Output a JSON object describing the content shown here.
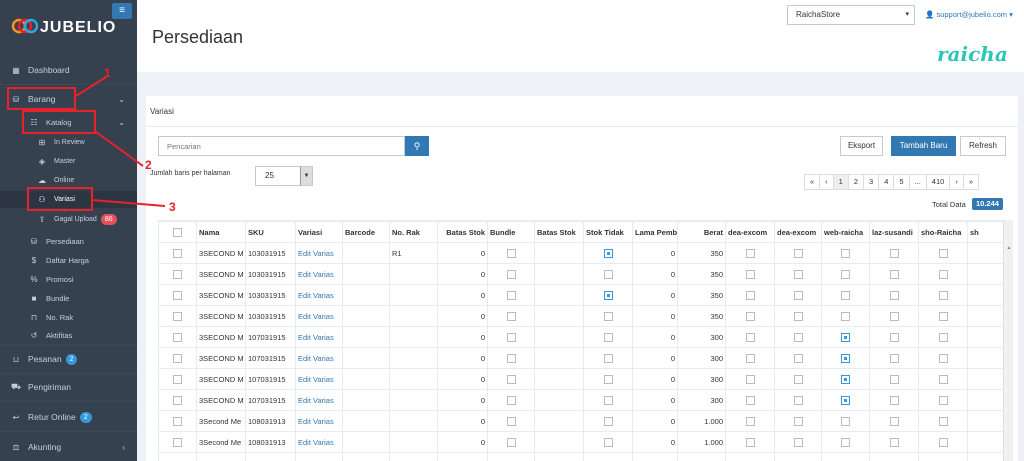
{
  "app": {
    "name": "JUBELIO",
    "menu_icon": "hamburger-icon"
  },
  "header": {
    "title": "Persediaan",
    "store": "RaichaStore",
    "user_email": "support@jubelio.com",
    "watermark": "raicha"
  },
  "sidebar": {
    "items": [
      {
        "label": "Dashboard",
        "icon": "chart-icon"
      },
      {
        "label": "Barang",
        "icon": "cubes-icon"
      },
      {
        "label": "Katalog",
        "icon": "grid-icon"
      },
      {
        "label": "In Review",
        "icon": "plus-square-icon"
      },
      {
        "label": "Master",
        "icon": "cube-icon"
      },
      {
        "label": "Online",
        "icon": "cloud-icon"
      },
      {
        "label": "Variasi",
        "icon": "sitemap-icon"
      },
      {
        "label": "Gagal Upload",
        "icon": "upload-icon",
        "badge": "86"
      },
      {
        "label": "Persediaan",
        "icon": "cubes-icon"
      },
      {
        "label": "Daftar Harga",
        "icon": "dollar-icon"
      },
      {
        "label": "Promosi",
        "icon": "percent-icon"
      },
      {
        "label": "Bundle",
        "icon": "square-icon"
      },
      {
        "label": "No. Rak",
        "icon": "bookmark-icon"
      },
      {
        "label": "Aktifitas",
        "icon": "history-icon"
      },
      {
        "label": "Pesanan",
        "icon": "basket-icon",
        "badge": "2"
      },
      {
        "label": "Pengiriman",
        "icon": "truck-icon"
      },
      {
        "label": "Retur Online",
        "icon": "reply-icon",
        "badge": "2"
      },
      {
        "label": "Akunting",
        "icon": "balance-icon"
      }
    ]
  },
  "annotations": [
    "1",
    "2",
    "3"
  ],
  "panel": {
    "title": "Variasi",
    "search_placeholder": "Pencarian",
    "export_label": "Eksport",
    "add_label": "Tambah Baru",
    "refresh_label": "Refresh",
    "rows_label": "Jumlah baris per halaman",
    "rows_value": "25",
    "pager": [
      "«",
      "‹",
      "1",
      "2",
      "3",
      "4",
      "5",
      "...",
      "410",
      "›",
      "»"
    ],
    "current_page": "1",
    "total_label": "Total Data",
    "total_value": "10.244"
  },
  "table": {
    "columns": [
      "Nama",
      "SKU",
      "Variasi",
      "Barcode",
      "No. Rak",
      "Batas Stok",
      "Bundle",
      "Batas Stok",
      "Stok Tidak",
      "Lama Pemb",
      "Berat",
      "dea-excom",
      "dea-excom",
      "web-raicha",
      "laz-susandi",
      "sho-Raicha",
      "sh"
    ],
    "rows": [
      {
        "nama": "3SECOND M",
        "sku": "103031915",
        "variasi": "Edit Varias",
        "rak": "R1",
        "batas": "0",
        "stok_tidak": true,
        "lama": "0",
        "berat": "350",
        "web": false
      },
      {
        "nama": "3SECOND M",
        "sku": "103031915",
        "variasi": "Edit Varias",
        "rak": "",
        "batas": "0",
        "stok_tidak": false,
        "lama": "0",
        "berat": "350",
        "web": false
      },
      {
        "nama": "3SECOND M",
        "sku": "103031915",
        "variasi": "Edit Varias",
        "rak": "",
        "batas": "0",
        "stok_tidak": true,
        "lama": "0",
        "berat": "350",
        "web": false
      },
      {
        "nama": "3SECOND M",
        "sku": "103031915",
        "variasi": "Edit Varias",
        "rak": "",
        "batas": "0",
        "stok_tidak": false,
        "lama": "0",
        "berat": "350",
        "web": false
      },
      {
        "nama": "3SECOND M",
        "sku": "107031915",
        "variasi": "Edit Varias",
        "rak": "",
        "batas": "0",
        "stok_tidak": false,
        "lama": "0",
        "berat": "300",
        "web": true
      },
      {
        "nama": "3SECOND M",
        "sku": "107031915",
        "variasi": "Edit Varias",
        "rak": "",
        "batas": "0",
        "stok_tidak": false,
        "lama": "0",
        "berat": "300",
        "web": true
      },
      {
        "nama": "3SECOND M",
        "sku": "107031915",
        "variasi": "Edit Varias",
        "rak": "",
        "batas": "0",
        "stok_tidak": false,
        "lama": "0",
        "berat": "300",
        "web": true
      },
      {
        "nama": "3SECOND M",
        "sku": "107031915",
        "variasi": "Edit Varias",
        "rak": "",
        "batas": "0",
        "stok_tidak": false,
        "lama": "0",
        "berat": "300",
        "web": true
      },
      {
        "nama": "3Second Me",
        "sku": "108031913",
        "variasi": "Edit Varias",
        "rak": "",
        "batas": "0",
        "stok_tidak": false,
        "lama": "0",
        "berat": "1.000",
        "web": false
      },
      {
        "nama": "3Second Me",
        "sku": "108031913",
        "variasi": "Edit Varias",
        "rak": "",
        "batas": "0",
        "stok_tidak": false,
        "lama": "0",
        "berat": "1.000",
        "web": false
      },
      {
        "nama": "",
        "sku": "",
        "variasi": "",
        "rak": "",
        "batas": "",
        "stok_tidak": false,
        "lama": "",
        "berat": "",
        "web": false
      }
    ]
  }
}
